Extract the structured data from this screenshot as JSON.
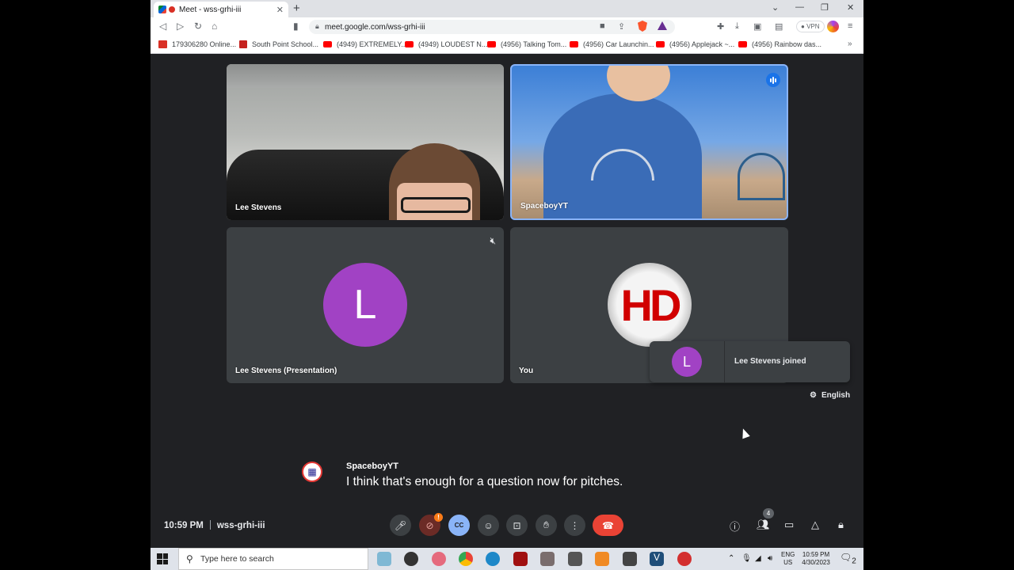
{
  "browser": {
    "tab_title": "Meet - wss-grhi-iii",
    "url": "meet.google.com/wss-grhi-iii",
    "vpn_label": "VPN",
    "bookmarks": [
      "179306280 Online...",
      "South Point School...",
      "(4949) EXTREMELY...",
      "(4949) LOUDEST N...",
      "(4956) Talking Tom...",
      "(4956) Car Launchin...",
      "(4956) Applejack ~...",
      "(4956) Rainbow das..."
    ]
  },
  "meet": {
    "tiles": [
      {
        "name": "Lee Stevens"
      },
      {
        "name": "SpaceboyYT"
      },
      {
        "name": "Lee Stevens (Presentation)",
        "initial": "L"
      },
      {
        "name": "You",
        "avatar_text": "HD"
      }
    ],
    "toast": {
      "initial": "L",
      "message": "Lee Stevens joined"
    },
    "caption_language": "English",
    "caption": {
      "speaker": "SpaceboyYT",
      "text": "I think that's enough for a question now for pitches."
    },
    "time": "10:59 PM",
    "meeting_code": "wss-grhi-iii",
    "camera_alert_badge": "!",
    "cc_label": "CC",
    "participant_count": "4"
  },
  "taskbar": {
    "search_placeholder": "Type here to search",
    "lang_line1": "ENG",
    "lang_line2": "US",
    "time": "10:59 PM",
    "date": "4/30/2023",
    "notification_count": "2"
  },
  "colors": {
    "meet_bg": "#202124",
    "tile_bg": "#3c4043",
    "hangup": "#ea4335",
    "avatar_purple": "#a142c4",
    "active_speaker": "#8ab4f8"
  }
}
